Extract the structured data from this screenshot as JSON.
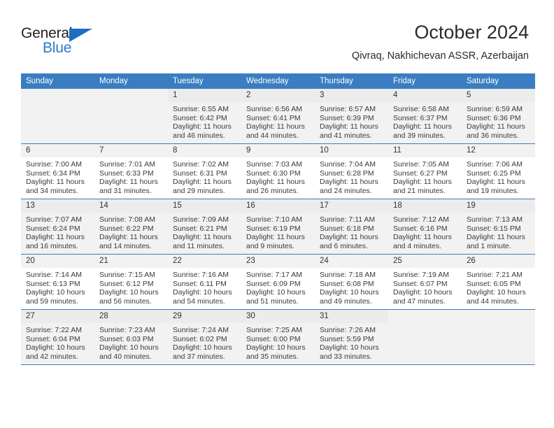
{
  "brand": {
    "name_top": "General",
    "name_bottom": "Blue",
    "triangle_icon": "triangle-icon",
    "color_top": "#231f20",
    "color_bottom": "#2b7cc4",
    "accent": "#1b6ec2"
  },
  "header": {
    "title": "October 2024",
    "subtitle": "Qivraq, Nakhichevan ASSR, Azerbaijan"
  },
  "calendar": {
    "header_bg": "#3a7ec1",
    "weekdays": [
      "Sunday",
      "Monday",
      "Tuesday",
      "Wednesday",
      "Thursday",
      "Friday",
      "Saturday"
    ],
    "weeks": [
      [
        {
          "empty": true
        },
        {
          "empty": true
        },
        {
          "day": "1",
          "sunrise": "Sunrise: 6:55 AM",
          "sunset": "Sunset: 6:42 PM",
          "daylight": "Daylight: 11 hours and 46 minutes."
        },
        {
          "day": "2",
          "sunrise": "Sunrise: 6:56 AM",
          "sunset": "Sunset: 6:41 PM",
          "daylight": "Daylight: 11 hours and 44 minutes."
        },
        {
          "day": "3",
          "sunrise": "Sunrise: 6:57 AM",
          "sunset": "Sunset: 6:39 PM",
          "daylight": "Daylight: 11 hours and 41 minutes."
        },
        {
          "day": "4",
          "sunrise": "Sunrise: 6:58 AM",
          "sunset": "Sunset: 6:37 PM",
          "daylight": "Daylight: 11 hours and 39 minutes."
        },
        {
          "day": "5",
          "sunrise": "Sunrise: 6:59 AM",
          "sunset": "Sunset: 6:36 PM",
          "daylight": "Daylight: 11 hours and 36 minutes."
        }
      ],
      [
        {
          "day": "6",
          "sunrise": "Sunrise: 7:00 AM",
          "sunset": "Sunset: 6:34 PM",
          "daylight": "Daylight: 11 hours and 34 minutes."
        },
        {
          "day": "7",
          "sunrise": "Sunrise: 7:01 AM",
          "sunset": "Sunset: 6:33 PM",
          "daylight": "Daylight: 11 hours and 31 minutes."
        },
        {
          "day": "8",
          "sunrise": "Sunrise: 7:02 AM",
          "sunset": "Sunset: 6:31 PM",
          "daylight": "Daylight: 11 hours and 29 minutes."
        },
        {
          "day": "9",
          "sunrise": "Sunrise: 7:03 AM",
          "sunset": "Sunset: 6:30 PM",
          "daylight": "Daylight: 11 hours and 26 minutes."
        },
        {
          "day": "10",
          "sunrise": "Sunrise: 7:04 AM",
          "sunset": "Sunset: 6:28 PM",
          "daylight": "Daylight: 11 hours and 24 minutes."
        },
        {
          "day": "11",
          "sunrise": "Sunrise: 7:05 AM",
          "sunset": "Sunset: 6:27 PM",
          "daylight": "Daylight: 11 hours and 21 minutes."
        },
        {
          "day": "12",
          "sunrise": "Sunrise: 7:06 AM",
          "sunset": "Sunset: 6:25 PM",
          "daylight": "Daylight: 11 hours and 19 minutes."
        }
      ],
      [
        {
          "day": "13",
          "sunrise": "Sunrise: 7:07 AM",
          "sunset": "Sunset: 6:24 PM",
          "daylight": "Daylight: 11 hours and 16 minutes."
        },
        {
          "day": "14",
          "sunrise": "Sunrise: 7:08 AM",
          "sunset": "Sunset: 6:22 PM",
          "daylight": "Daylight: 11 hours and 14 minutes."
        },
        {
          "day": "15",
          "sunrise": "Sunrise: 7:09 AM",
          "sunset": "Sunset: 6:21 PM",
          "daylight": "Daylight: 11 hours and 11 minutes."
        },
        {
          "day": "16",
          "sunrise": "Sunrise: 7:10 AM",
          "sunset": "Sunset: 6:19 PM",
          "daylight": "Daylight: 11 hours and 9 minutes."
        },
        {
          "day": "17",
          "sunrise": "Sunrise: 7:11 AM",
          "sunset": "Sunset: 6:18 PM",
          "daylight": "Daylight: 11 hours and 6 minutes."
        },
        {
          "day": "18",
          "sunrise": "Sunrise: 7:12 AM",
          "sunset": "Sunset: 6:16 PM",
          "daylight": "Daylight: 11 hours and 4 minutes."
        },
        {
          "day": "19",
          "sunrise": "Sunrise: 7:13 AM",
          "sunset": "Sunset: 6:15 PM",
          "daylight": "Daylight: 11 hours and 1 minute."
        }
      ],
      [
        {
          "day": "20",
          "sunrise": "Sunrise: 7:14 AM",
          "sunset": "Sunset: 6:13 PM",
          "daylight": "Daylight: 10 hours and 59 minutes."
        },
        {
          "day": "21",
          "sunrise": "Sunrise: 7:15 AM",
          "sunset": "Sunset: 6:12 PM",
          "daylight": "Daylight: 10 hours and 56 minutes."
        },
        {
          "day": "22",
          "sunrise": "Sunrise: 7:16 AM",
          "sunset": "Sunset: 6:11 PM",
          "daylight": "Daylight: 10 hours and 54 minutes."
        },
        {
          "day": "23",
          "sunrise": "Sunrise: 7:17 AM",
          "sunset": "Sunset: 6:09 PM",
          "daylight": "Daylight: 10 hours and 51 minutes."
        },
        {
          "day": "24",
          "sunrise": "Sunrise: 7:18 AM",
          "sunset": "Sunset: 6:08 PM",
          "daylight": "Daylight: 10 hours and 49 minutes."
        },
        {
          "day": "25",
          "sunrise": "Sunrise: 7:19 AM",
          "sunset": "Sunset: 6:07 PM",
          "daylight": "Daylight: 10 hours and 47 minutes."
        },
        {
          "day": "26",
          "sunrise": "Sunrise: 7:21 AM",
          "sunset": "Sunset: 6:05 PM",
          "daylight": "Daylight: 10 hours and 44 minutes."
        }
      ],
      [
        {
          "day": "27",
          "sunrise": "Sunrise: 7:22 AM",
          "sunset": "Sunset: 6:04 PM",
          "daylight": "Daylight: 10 hours and 42 minutes."
        },
        {
          "day": "28",
          "sunrise": "Sunrise: 7:23 AM",
          "sunset": "Sunset: 6:03 PM",
          "daylight": "Daylight: 10 hours and 40 minutes."
        },
        {
          "day": "29",
          "sunrise": "Sunrise: 7:24 AM",
          "sunset": "Sunset: 6:02 PM",
          "daylight": "Daylight: 10 hours and 37 minutes."
        },
        {
          "day": "30",
          "sunrise": "Sunrise: 7:25 AM",
          "sunset": "Sunset: 6:00 PM",
          "daylight": "Daylight: 10 hours and 35 minutes."
        },
        {
          "day": "31",
          "sunrise": "Sunrise: 7:26 AM",
          "sunset": "Sunset: 5:59 PM",
          "daylight": "Daylight: 10 hours and 33 minutes."
        },
        {
          "empty": true
        },
        {
          "empty": true
        }
      ]
    ]
  }
}
